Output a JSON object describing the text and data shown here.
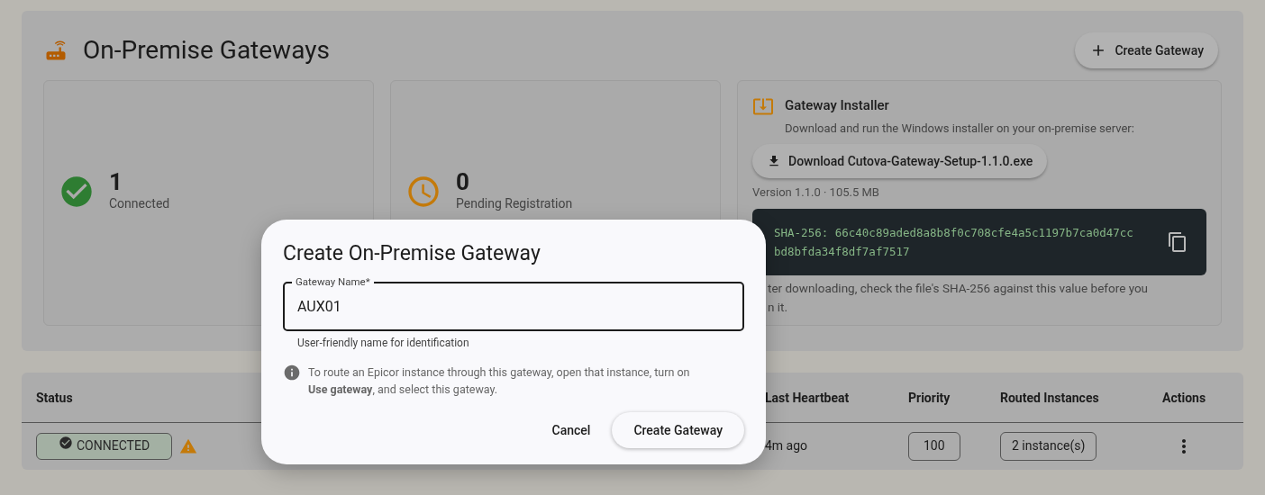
{
  "header": {
    "title": "On-Premise Gateways",
    "create_button": "Create Gateway"
  },
  "stats": [
    {
      "kind": "connected",
      "value": "1",
      "label": "Connected"
    },
    {
      "kind": "pending",
      "value": "0",
      "label": "Pending Registration"
    }
  ],
  "installer": {
    "title": "Gateway Installer",
    "description": "Download and run the Windows installer on your on-premise server:",
    "download_button": "Download Cutova-Gateway-Setup-1.1.0.exe",
    "version": "Version 1.1.0 · 105.5 MB",
    "hash": "SHA-256: 66c40c89aded8a8b8f0c708cfe4a5c1197b7ca0d47ccbd8bfda34f8df7af7517",
    "note_lines": [
      "ter downloading, check the file's SHA-256 against this value before you",
      "n it."
    ]
  },
  "table": {
    "columns": [
      "Status",
      "Last Heartbeat",
      "Priority",
      "Routed Instances",
      "Actions"
    ],
    "rows": [
      {
        "status": "CONNECTED",
        "warning": true,
        "last_heartbeat": "4m ago",
        "priority": "100",
        "routed_instances": "2 instance(s)"
      }
    ]
  },
  "dialog": {
    "title": "Create On-Premise Gateway",
    "field_label": "Gateway Name*",
    "field_value": "AUX01",
    "helper": "User-friendly name for identification",
    "info": "To route an Epicor instance through this gateway, open that instance, turn on **Use gateway**, and select this gateway.",
    "buttons": [
      "Cancel",
      "Create Gateway"
    ]
  }
}
